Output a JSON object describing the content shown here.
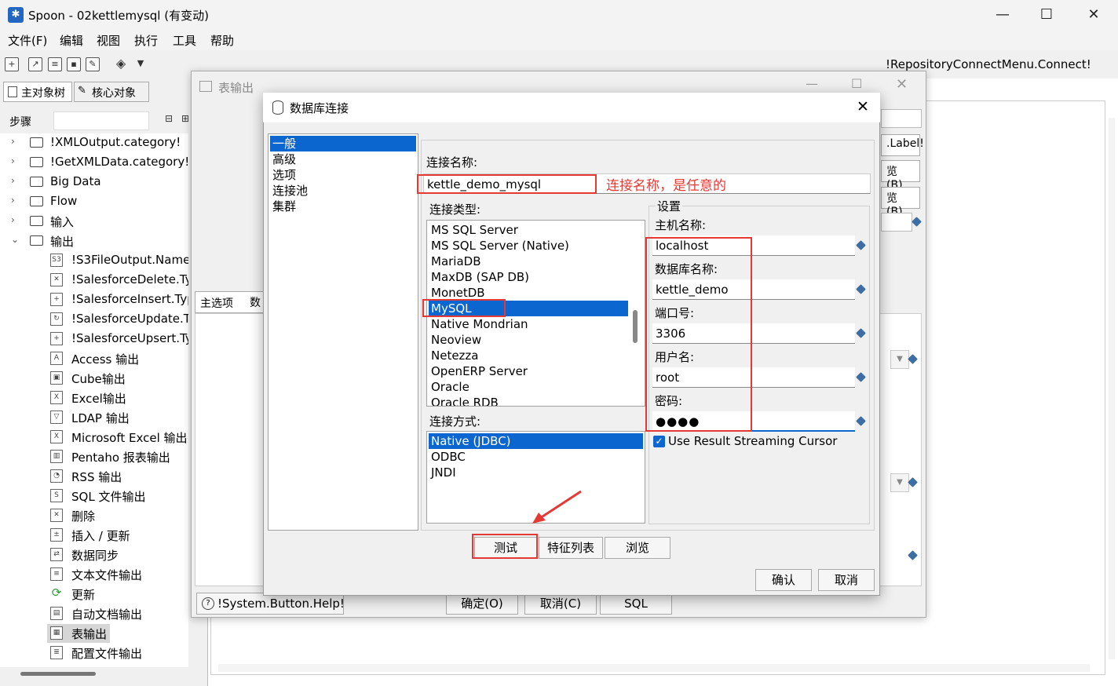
{
  "window": {
    "app_icon": "spoon-icon",
    "title": "Spoon - 02kettlemysql (有变动)",
    "minimize": "—",
    "maximize": "☐",
    "close": "✕"
  },
  "menu": [
    "文件(F)",
    "编辑",
    "视图",
    "执行",
    "工具",
    "帮助"
  ],
  "toolbar": {
    "repository_connect": "!RepositoryConnectMenu.Connect!"
  },
  "left_panel": {
    "tabs": [
      "主对象树",
      "核心对象"
    ],
    "steps_label": "步骤",
    "tree_categories": [
      {
        "label": "!XMLOutput.category!",
        "expanded": false
      },
      {
        "label": "!GetXMLData.category!",
        "expanded": false
      },
      {
        "label": "Big Data",
        "expanded": false
      },
      {
        "label": "Flow",
        "expanded": false
      },
      {
        "label": "输入",
        "expanded": false
      },
      {
        "label": "输出",
        "expanded": true
      }
    ],
    "output_steps": [
      "!S3FileOutput.Name",
      "!SalesforceDelete.Ty",
      "!SalesforceInsert.Typ",
      "!SalesforceUpdate.T",
      "!SalesforceUpsert.Ty",
      "Access 输出",
      "Cube输出",
      "Excel输出",
      "LDAP 输出",
      "Microsoft Excel 输出",
      "Pentaho 报表输出",
      "RSS 输出",
      "SQL 文件输出",
      "删除",
      "插入 / 更新",
      "数据同步",
      "文本文件输出",
      "更新",
      "自动文档输出",
      "表输出",
      "配置文件输出"
    ],
    "selected_step": "表输出"
  },
  "table_output_dialog": {
    "title": "表输出",
    "tab_main": "主选项",
    "tab_db": "数",
    "label_button": ".Label!",
    "browse1": "览(B)...",
    "browse2": "览(B)...",
    "help": "!System.Button.Help!",
    "ok": "确定(O)",
    "cancel": "取消(C)",
    "sql": "SQL"
  },
  "db_dialog": {
    "title": "数据库连接",
    "nav": [
      "一般",
      "高级",
      "选项",
      "连接池",
      "集群"
    ],
    "nav_selected": "一般",
    "conn_name_label": "连接名称:",
    "conn_name_value": "kettle_demo_mysql",
    "conn_name_note": "连接名称，是任意的",
    "conn_type_label": "连接类型:",
    "conn_types": [
      "MS SQL Server",
      "MS SQL Server (Native)",
      "MariaDB",
      "MaxDB (SAP DB)",
      "MonetDB",
      "MySQL",
      "Native Mondrian",
      "Neoview",
      "Netezza",
      "OpenERP Server",
      "Oracle",
      "Oracle RDB"
    ],
    "conn_type_selected": "MySQL",
    "access_label": "连接方式:",
    "access_types": [
      "Native (JDBC)",
      "ODBC",
      "JNDI"
    ],
    "access_selected": "Native (JDBC)",
    "settings_label": "设置",
    "host_label": "主机名称:",
    "host_value": "localhost",
    "dbname_label": "数据库名称:",
    "dbname_value": "kettle_demo",
    "port_label": "端口号:",
    "port_value": "3306",
    "user_label": "用户名:",
    "user_value": "root",
    "password_label": "密码:",
    "password_value": "●●●●",
    "streaming_label": "Use Result Streaming Cursor",
    "streaming_checked": true,
    "btn_test": "测试",
    "btn_features": "特征列表",
    "btn_browse": "浏览",
    "btn_ok": "确认",
    "btn_cancel": "取消"
  }
}
